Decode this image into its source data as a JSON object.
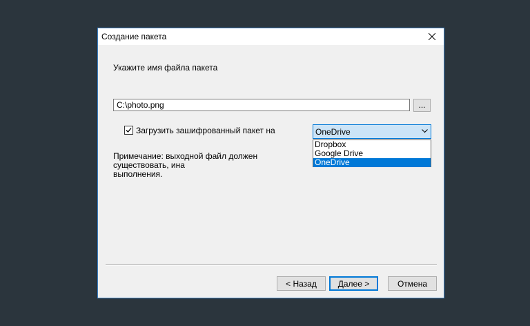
{
  "dialog": {
    "title": "Создание пакета",
    "close_icon": "close-icon",
    "prompt": "Укажите имя файла пакета",
    "file_path": "C:\\photo.png",
    "browse_label": "...",
    "upload_checkbox": {
      "label": "Загрузить зашифрованный пакет на",
      "checked": true
    },
    "cloud_select": {
      "selected": "OneDrive",
      "options": [
        "Dropbox",
        "Google Drive",
        "OneDrive"
      ],
      "arrow_icon": "chevron-down-icon"
    },
    "note": "Примечание: выходной файл должен существовать, ина выполнения.",
    "note_line1": "Примечание: выходной файл должен существовать, ина",
    "note_line2": "выполнения.",
    "buttons": {
      "back": "< Назад",
      "next": "Далее >",
      "cancel": "Отмена"
    },
    "colors": {
      "accent": "#0078d7",
      "desktop": "#2b353d",
      "dialog_bg": "#f0f0f0"
    }
  }
}
